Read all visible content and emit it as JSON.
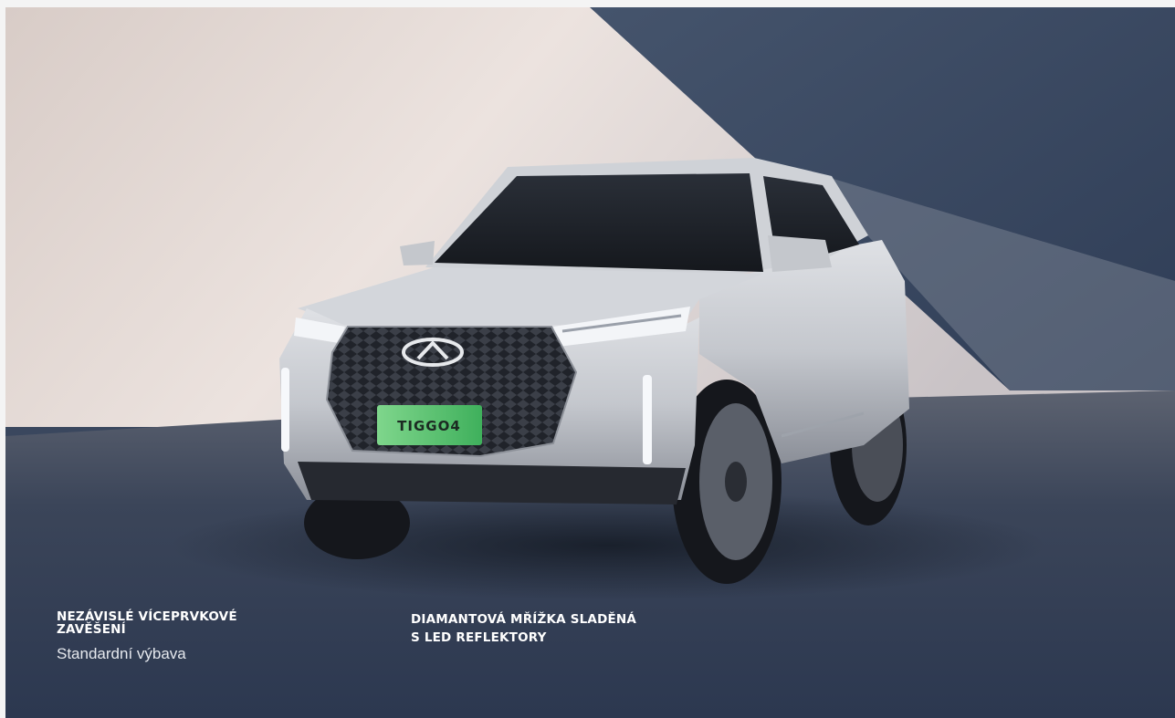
{
  "car": {
    "plate_text": "TIGGO4"
  },
  "features": [
    {
      "title": "NEZÁVISLÉ VÍCEPRVKOVÉ\nZAVĚŠENÍ",
      "subtitle": "Standardní výbava"
    },
    {
      "title": "DIAMANTOVÁ MŘÍŽKA SLADĚNÁ\nS LED REFLEKTORY"
    }
  ],
  "colors": {
    "wall_light": "#e4dcd8",
    "wall_dark": "#3a4a63",
    "floor": "#2e3a50",
    "car_body": "#c9ccd2",
    "plate": "#4cc06a",
    "text": "#ffffff"
  }
}
